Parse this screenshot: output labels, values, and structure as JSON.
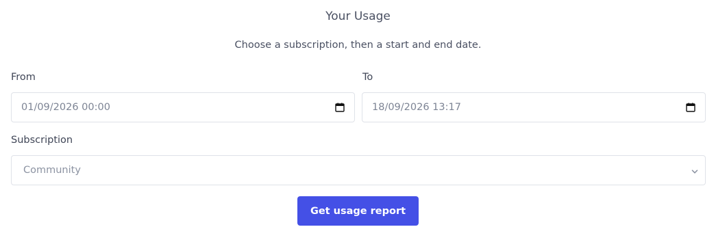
{
  "page": {
    "title": "Your Usage",
    "subtitle": "Choose a subscription, then a start and end date."
  },
  "form": {
    "from": {
      "label": "From",
      "value": "01/09/2026 00:00",
      "icon": "calendar-icon"
    },
    "to": {
      "label": "To",
      "value": "18/09/2026 13:17",
      "icon": "calendar-icon"
    },
    "subscription": {
      "label": "Subscription",
      "selected": "Community",
      "icon": "chevron-down-icon"
    },
    "submit_label": "Get usage report"
  },
  "colors": {
    "accent": "#4450e6",
    "border": "#dfe2e8",
    "text": "#4a5062",
    "muted_text": "#7d8494"
  }
}
